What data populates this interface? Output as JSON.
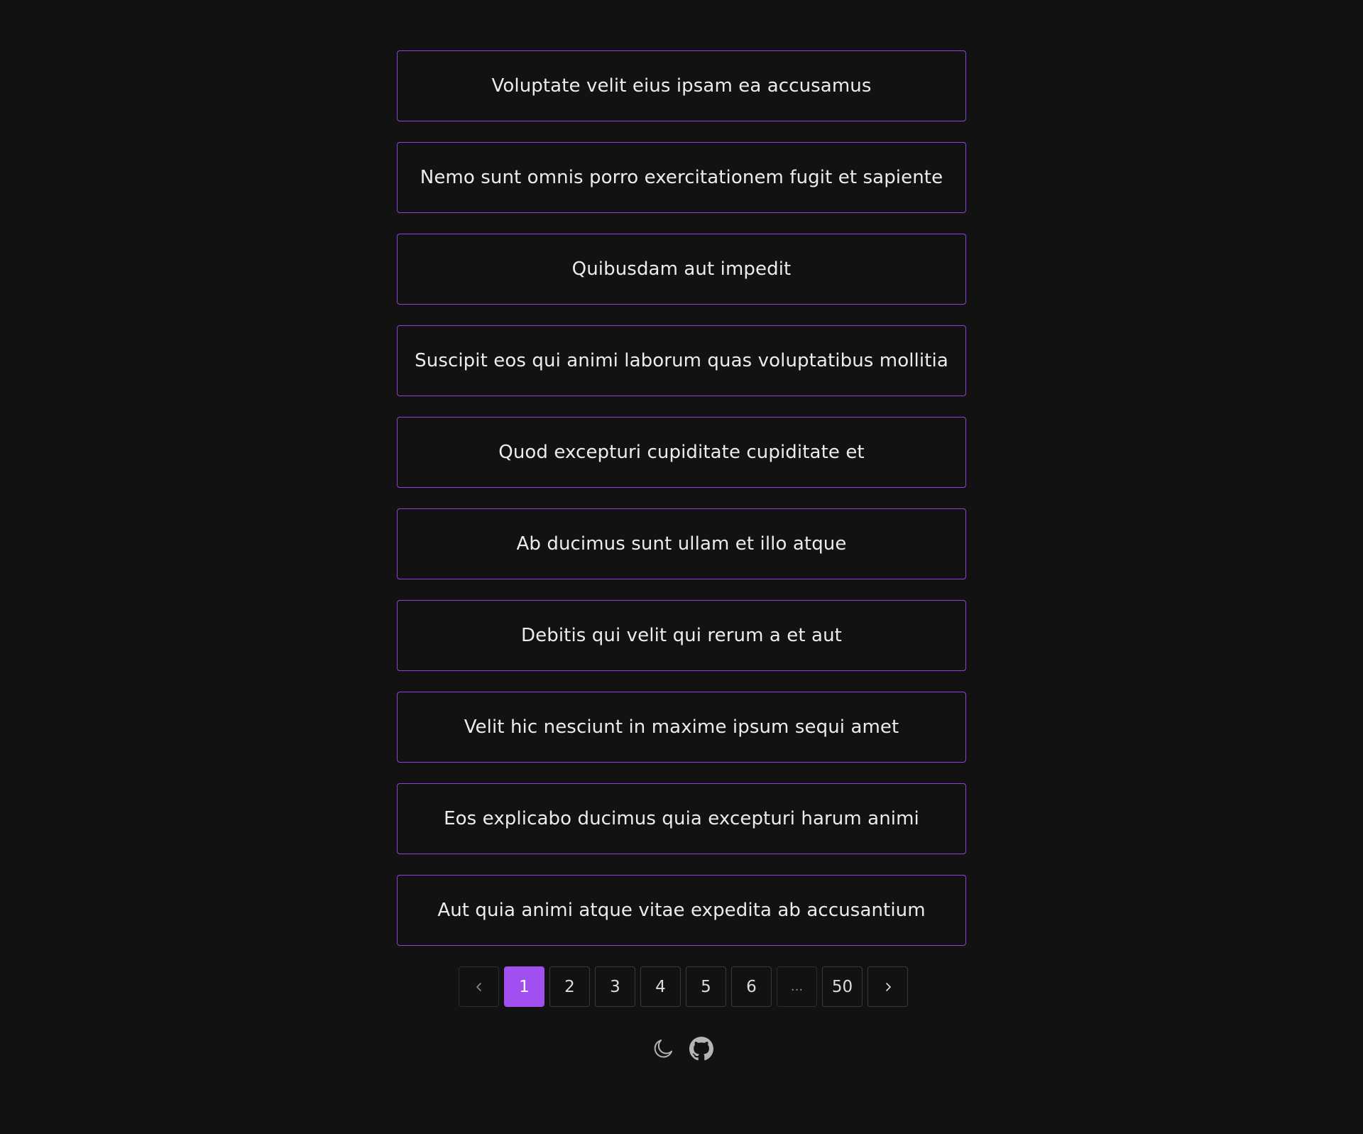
{
  "items": [
    "Voluptate velit eius ipsam ea accusamus",
    "Nemo sunt omnis porro exercitationem fugit et sapiente",
    "Quibusdam aut impedit",
    "Suscipit eos qui animi laborum quas voluptatibus mollitia",
    "Quod excepturi cupiditate cupiditate et",
    "Ab ducimus sunt ullam et illo atque",
    "Debitis qui velit qui rerum a et aut",
    "Velit hic nesciunt in maxime ipsum sequi amet",
    "Eos explicabo ducimus quia excepturi harum animi",
    "Aut quia animi atque vitae expedita ab accusantium"
  ],
  "pagination": {
    "current": 1,
    "pages": [
      "1",
      "2",
      "3",
      "4",
      "5",
      "6",
      "...",
      "50"
    ],
    "prev_icon": "chevron-left-icon",
    "next_icon": "chevron-right-icon"
  },
  "footer": {
    "icons": [
      "moon-icon",
      "github-icon"
    ]
  },
  "colors": {
    "background": "#121213",
    "accent": "#a14ff0",
    "item_border": "#8a45d8",
    "text": "#ececec"
  }
}
